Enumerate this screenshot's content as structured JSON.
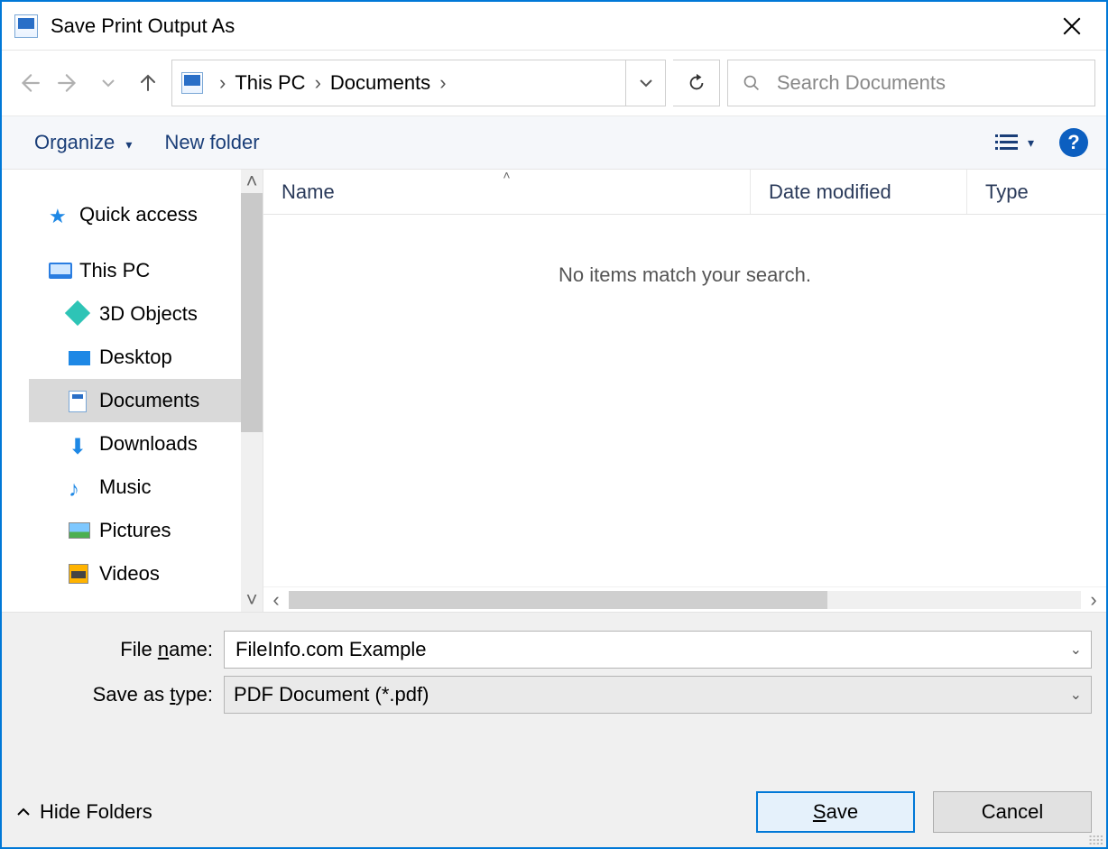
{
  "title": "Save Print Output As",
  "address": {
    "crumb1": "This PC",
    "crumb2": "Documents"
  },
  "search": {
    "placeholder": "Search Documents"
  },
  "toolbar": {
    "organize": "Organize",
    "newfolder": "New folder"
  },
  "sidebar": {
    "quick_access": "Quick access",
    "this_pc": "This PC",
    "items": [
      "3D Objects",
      "Desktop",
      "Documents",
      "Downloads",
      "Music",
      "Pictures",
      "Videos"
    ]
  },
  "columns": {
    "name": "Name",
    "date": "Date modified",
    "type": "Type"
  },
  "content": {
    "empty": "No items match your search."
  },
  "form": {
    "filename_label_pre": "File ",
    "filename_label_ul": "n",
    "filename_label_post": "ame:",
    "filename_value": "FileInfo.com Example",
    "saveas_label_pre": "Save as ",
    "saveas_label_ul": "t",
    "saveas_label_post": "ype:",
    "saveas_value": "PDF Document (*.pdf)"
  },
  "footer": {
    "hide_folders": "Hide Folders",
    "save_ul": "S",
    "save_rest": "ave",
    "cancel": "Cancel"
  }
}
